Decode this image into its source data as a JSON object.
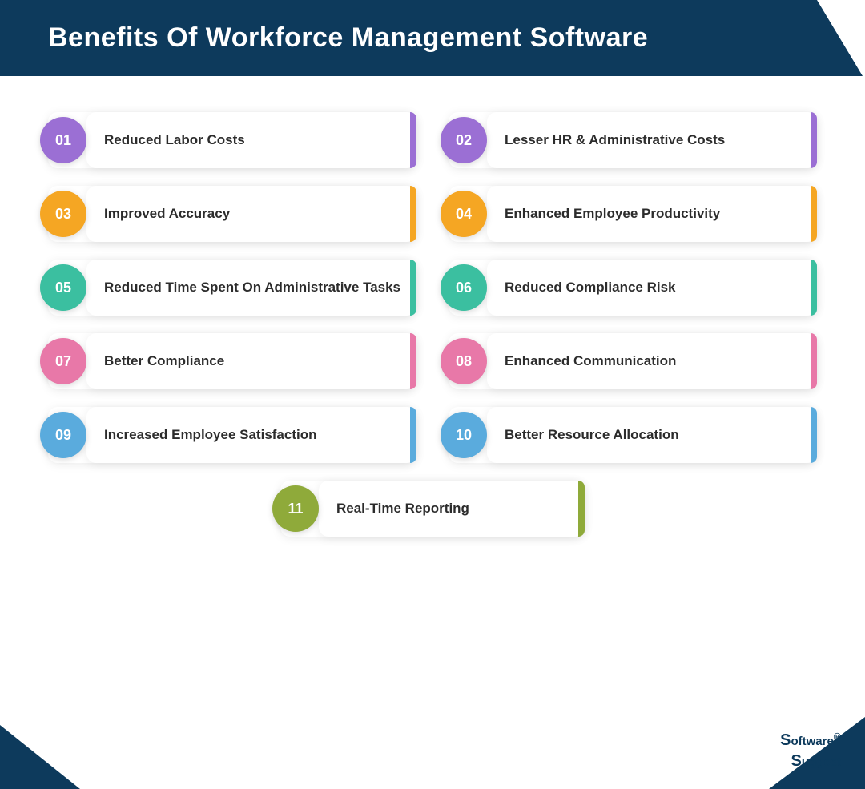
{
  "header": {
    "title": "Benefits Of Workforce Management Software"
  },
  "benefits": [
    {
      "id": "01",
      "text": "Reduced Labor Costs",
      "color": "purple",
      "accent": "accent-purple"
    },
    {
      "id": "02",
      "text": "Lesser HR & Administrative Costs",
      "color": "purple",
      "accent": "accent-purple"
    },
    {
      "id": "03",
      "text": "Improved Accuracy",
      "color": "orange",
      "accent": "accent-orange"
    },
    {
      "id": "04",
      "text": "Enhanced Employee Productivity",
      "color": "orange",
      "accent": "accent-orange"
    },
    {
      "id": "05",
      "text": "Reduced Time Spent On Administrative Tasks",
      "color": "teal",
      "accent": "accent-teal"
    },
    {
      "id": "06",
      "text": "Reduced Compliance Risk",
      "color": "teal",
      "accent": "accent-teal"
    },
    {
      "id": "07",
      "text": "Better Compliance",
      "color": "pink",
      "accent": "accent-pink"
    },
    {
      "id": "08",
      "text": "Enhanced Communication",
      "color": "pink",
      "accent": "accent-pink"
    },
    {
      "id": "09",
      "text": "Increased Employee Satisfaction",
      "color": "blue",
      "accent": "accent-blue"
    },
    {
      "id": "10",
      "text": "Better Resource Allocation",
      "color": "blue",
      "accent": "accent-blue"
    },
    {
      "id": "11",
      "text": "Real-Time Reporting",
      "color": "olive",
      "accent": "accent-olive"
    }
  ],
  "watermark": {
    "line1": "Software",
    "line2": "Suggest",
    "registered": "®"
  }
}
